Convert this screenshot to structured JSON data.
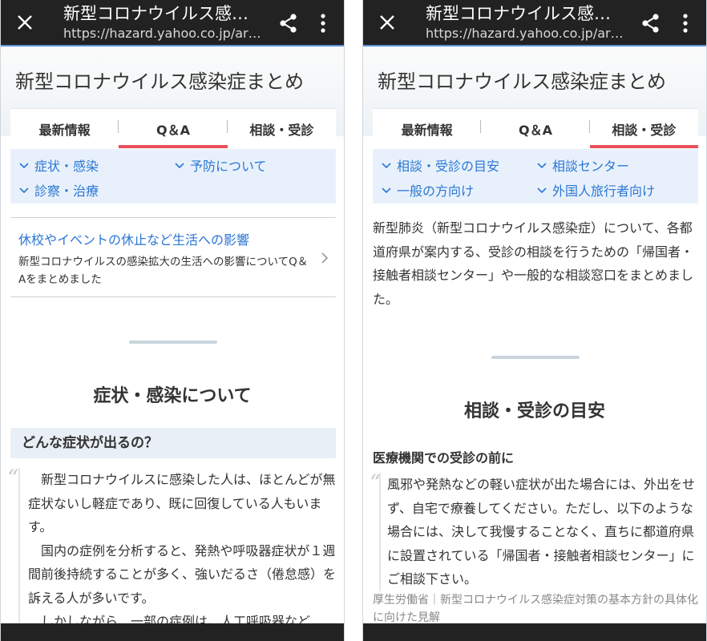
{
  "browser": {
    "title": "新型コロナウイルス感染症まとめ",
    "url": "https://hazard.yahoo.co.jp/article/..."
  },
  "page": {
    "title": "新型コロナウイルス感染症まとめ",
    "tabs": [
      "最新情報",
      "Q＆A",
      "相談・受診"
    ]
  },
  "left": {
    "active_tab": 1,
    "subnav": [
      "症状・感染",
      "予防について",
      "診察・治療"
    ],
    "story": {
      "title": "休校やイベントの休止など生活への影響",
      "desc": "新型コロナウイルスの感染拡大の生活への影響についてQ＆Aをまとめました"
    },
    "section_title": "症状・感染について",
    "question": "どんな症状が出るの？",
    "answer_p1": "新型コロナウイルスに感染した人は、ほとんどが無症状ないし軽症であり、既に回復している人もいます。",
    "answer_p2": "国内の症例を分析すると、発熱や呼吸器症状が１週間前後持続することが多く、強いだるさ（倦怠感）を訴える人が多いです。",
    "answer_p3": "しかしながら、一部の症例は、人工呼吸器など"
  },
  "right": {
    "active_tab": 2,
    "subnav": [
      "相談・受診の目安",
      "相談センター",
      "一般の方向け",
      "外国人旅行者向け"
    ],
    "intro": "新型肺炎（新型コロナウイルス感染症）について、各都道府県が案内する、受診の相談を行うための「帰国者・接触者相談センター」や一般的な相談窓口をまとめました。",
    "section_title": "相談・受診の目安",
    "subhead": "医療機関での受診の前に",
    "quote": "風邪や発熱などの軽い症状が出た場合には、外出をせず、自宅で療養してください。ただし、以下のような場合には、決して我慢することなく、直ちに都道府県に設置されている「帰国者・接触者相談センター」にご相談下さい。",
    "source": "厚生労働省｜新型コロナウイルス感染症対策の基本方針の具体化に向けた見解"
  },
  "colors": {
    "topbar": "#222222",
    "link": "#2b76d4",
    "active_tab_underline": "#e8505b",
    "subnav_bg": "#e8f1fb"
  },
  "icons": [
    "close-icon",
    "share-icon",
    "more-vert-icon",
    "chevron-down-icon",
    "chevron-right-icon",
    "quote-icon"
  ]
}
